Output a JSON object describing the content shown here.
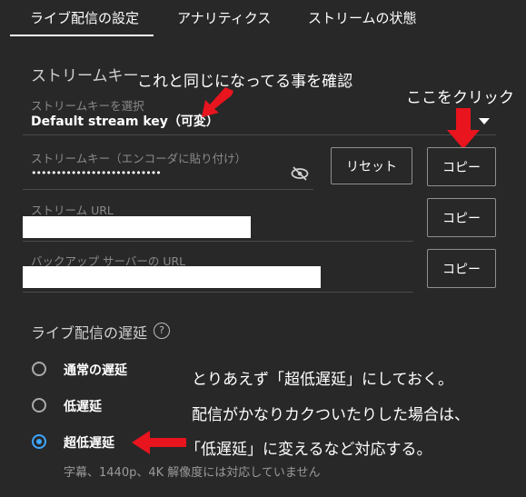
{
  "tabs": [
    "ライブ配信の設定",
    "アナリティクス",
    "ストリームの状態"
  ],
  "stream_key_section": {
    "title": "ストリームキー",
    "select_label": "ストリームキーを選択",
    "select_value": "Default stream key（可変）",
    "key_label": "ストリームキー（エンコーダに貼り付け）",
    "key_value": "••••••••••••••••••••••••••",
    "reset_button": "リセット",
    "copy_button": "コピー",
    "url_label": "ストリーム URL",
    "url_copy_button": "コピー",
    "backup_label": "バックアップ サーバーの URL",
    "backup_copy_button": "コピー"
  },
  "latency": {
    "title": "ライブ配信の遅延",
    "options": [
      "通常の遅延",
      "低遅延",
      "超低遅延"
    ],
    "selected": "超低遅延",
    "note": "字幕、1440p、4K 解像度には対応していません"
  },
  "annotations": {
    "confirm": "これと同じになってる事を確認",
    "click_here": "ここをクリック",
    "line1": "とりあえず「超低遅延」にしておく。",
    "line2": "配信がかなりカクついたりした場合は、",
    "line3": "「低遅延」に変えるなど対応する。"
  },
  "colors": {
    "background": "#282828",
    "arrow": "#e8141e",
    "radio_selected": "#3ea6ff"
  },
  "icons": [
    "visibility-off-icon",
    "dropdown-arrow-icon",
    "help-icon",
    "red-arrow-icon"
  ]
}
